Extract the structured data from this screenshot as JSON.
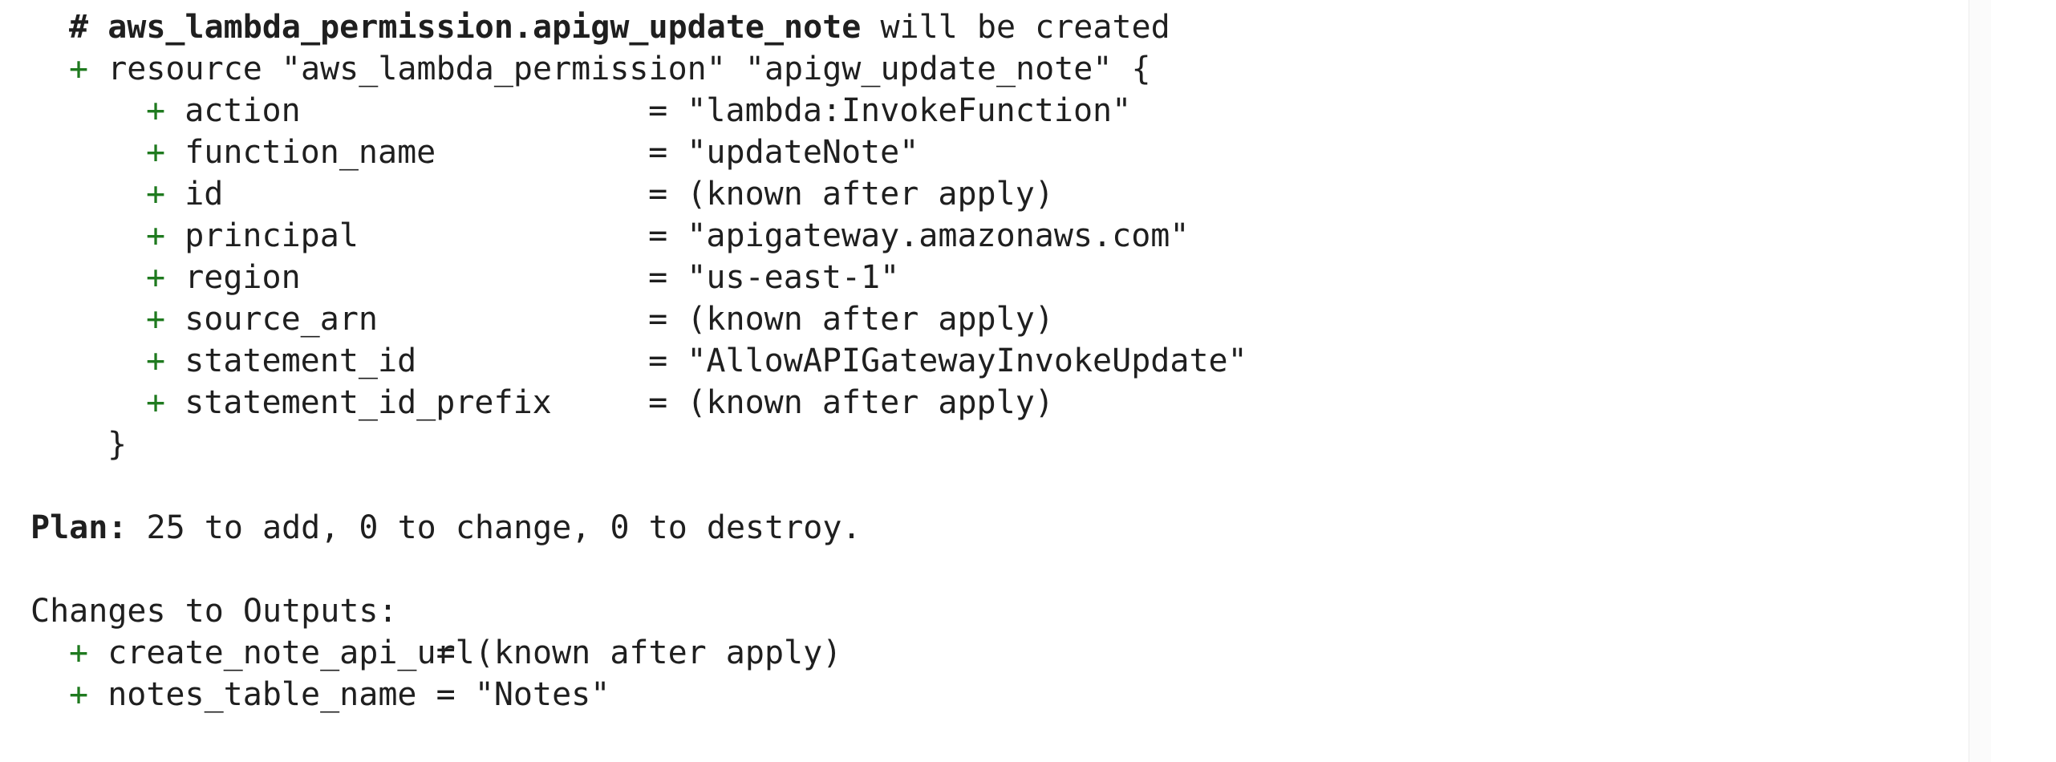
{
  "resource_block": {
    "comment": {
      "hash": "#",
      "address": "aws_lambda_permission.apigw_update_note",
      "suffix": " will be created"
    },
    "header": {
      "sign": "+",
      "text": "resource \"aws_lambda_permission\" \"apigw_update_note\" {"
    },
    "attributes": [
      {
        "sign": "+",
        "key": "action",
        "value": "= \"lambda:InvokeFunction\""
      },
      {
        "sign": "+",
        "key": "function_name",
        "value": "= \"updateNote\""
      },
      {
        "sign": "+",
        "key": "id",
        "value": "= (known after apply)"
      },
      {
        "sign": "+",
        "key": "principal",
        "value": "= \"apigateway.amazonaws.com\""
      },
      {
        "sign": "+",
        "key": "region",
        "value": "= \"us-east-1\""
      },
      {
        "sign": "+",
        "key": "source_arn",
        "value": "= (known after apply)"
      },
      {
        "sign": "+",
        "key": "statement_id",
        "value": "= \"AllowAPIGatewayInvokeUpdate\""
      },
      {
        "sign": "+",
        "key": "statement_id_prefix",
        "value": "= (known after apply)"
      }
    ],
    "closing": "}"
  },
  "plan": {
    "label": "Plan:",
    "summary": " 25 to add, 0 to change, 0 to destroy."
  },
  "outputs": {
    "title": "Changes to Outputs:",
    "items": [
      {
        "sign": "+",
        "key": "create_note_api_url",
        "value": "= (known after apply)"
      },
      {
        "sign": "+",
        "key": "notes_table_name",
        "value": "= \"Notes\""
      }
    ]
  },
  "colors": {
    "plus": "#1f7a1f",
    "text": "#1f1f1f",
    "background": "#ffffff"
  }
}
